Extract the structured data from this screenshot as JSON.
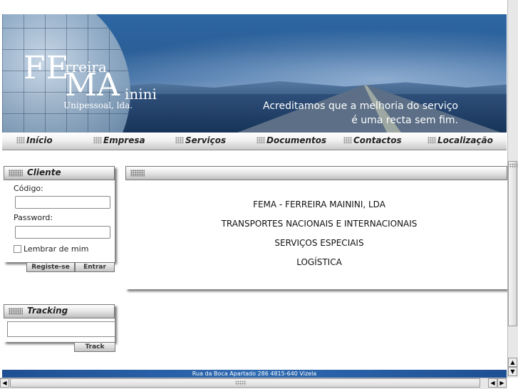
{
  "logo": {
    "fe": "FE",
    "rreira": "rreira",
    "ma": "MA",
    "inini": "inini",
    "unipessoal": "Unipessoal, lda."
  },
  "slogan": {
    "line1": "Acreditamos que a melhoria do serviço",
    "line2": "é uma recta sem fim."
  },
  "nav": {
    "items": [
      "Início",
      "Empresa",
      "Serviços",
      "Documentos",
      "Contactos",
      "Localização"
    ]
  },
  "cliente": {
    "title": "Cliente",
    "codigo_label": "Código:",
    "codigo_value": "",
    "password_label": "Password:",
    "password_value": "",
    "remember_label": "Lembrar de mim",
    "register_label": "Registe-se",
    "enter_label": "Entrar"
  },
  "tracking": {
    "title": "Tracking",
    "input_value": "",
    "track_label": "Track"
  },
  "content": {
    "lines": [
      "FEMA - FERREIRA MAININI, LDA",
      "TRANSPORTES NACIONAIS E INTERNACIONAIS",
      "SERVIÇOS ESPECIAIS",
      "LOGÍSTICA"
    ]
  },
  "footer": {
    "address": "Rua da Boca Apartado 286 4815-640 Vizela"
  },
  "scrollbars": {
    "up_icon": "arrow-up-icon",
    "down_icon": "arrow-down-icon",
    "left_icon": "arrow-left-icon",
    "right_icon": "arrow-right-icon"
  }
}
